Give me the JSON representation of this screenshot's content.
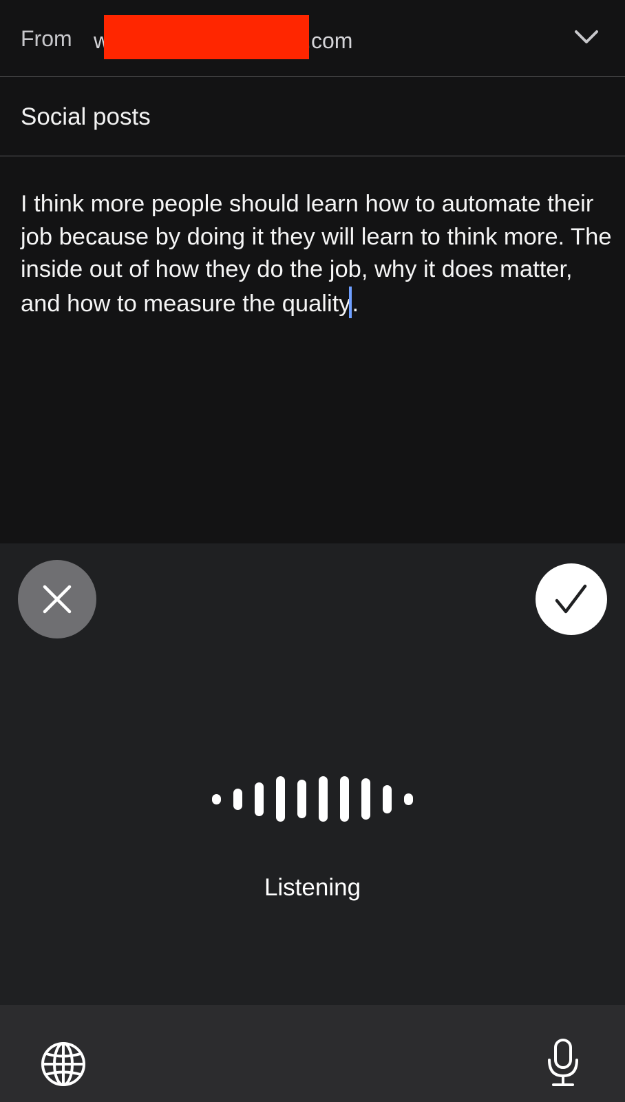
{
  "compose": {
    "from_label": "From",
    "from_prefix": "w",
    "from_suffix": ".com",
    "subject": "Social posts",
    "body_before_caret": "I think more people should learn how to automate their job because by doing it they will learn to think more. The inside out of how they do the job, why it does matter, and how to measure the quality",
    "body_after_caret": "."
  },
  "dictation": {
    "status": "Listening",
    "cancel_icon": "close-icon",
    "confirm_icon": "checkmark-icon"
  },
  "bottom_bar": {
    "left_icon": "globe-icon",
    "right_icon": "microphone-icon"
  },
  "colors": {
    "background": "#131314",
    "panel": "#1f2022",
    "bottom_bar": "#2c2c2e",
    "redaction": "#ff2600",
    "caret": "#6f9fff"
  }
}
